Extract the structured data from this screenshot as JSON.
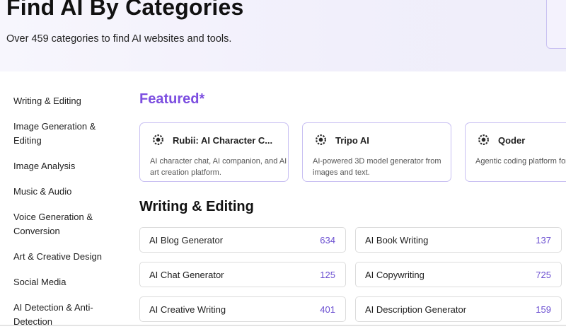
{
  "hero": {
    "title": "Find AI By Categories",
    "subtitle": "Over 459 categories to find AI websites and tools."
  },
  "sidebar": {
    "items": [
      {
        "label": "Writing & Editing"
      },
      {
        "label": "Image Generation & Editing"
      },
      {
        "label": "Image Analysis"
      },
      {
        "label": "Music & Audio"
      },
      {
        "label": "Voice Generation & Conversion"
      },
      {
        "label": "Art & Creative Design"
      },
      {
        "label": "Social Media"
      },
      {
        "label": "AI Detection & Anti-Detection"
      }
    ]
  },
  "featured": {
    "title": "Featured*",
    "cards": [
      {
        "name": "Rubii: AI Character C...",
        "description": "AI character chat, AI companion, and AI art creation platform.",
        "icon": "app-logo-icon"
      },
      {
        "name": "Tripo AI",
        "description": "AI-powered 3D model generator from images and text.",
        "icon": "app-logo-icon"
      },
      {
        "name": "Qoder",
        "description": "Agentic coding platform for software development wi",
        "icon": "app-logo-icon"
      }
    ]
  },
  "section": {
    "title": "Writing & Editing",
    "categories": [
      {
        "name": "AI Blog Generator",
        "count": "634"
      },
      {
        "name": "AI Book Writing",
        "count": "137"
      },
      {
        "name": "AI Chat Generator",
        "count": "125"
      },
      {
        "name": "AI Copywriting",
        "count": "725"
      },
      {
        "name": "AI Creative Writing",
        "count": "401"
      },
      {
        "name": "AI Description Generator",
        "count": "159"
      }
    ]
  },
  "colors": {
    "accent": "#7c4ee0",
    "count": "#6b4fd1",
    "hero_bg": "#f3f1fc",
    "card_border": "#c8bff2"
  }
}
